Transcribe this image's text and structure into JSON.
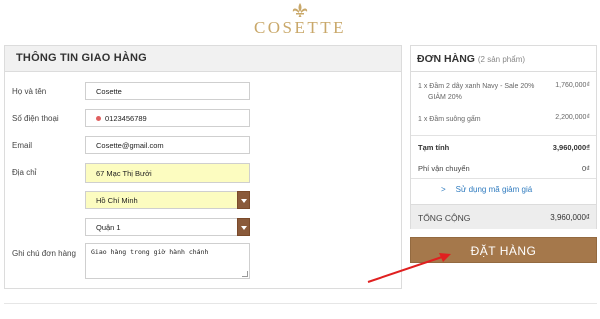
{
  "brand": "COSETTE",
  "shipping": {
    "title": "THÔNG TIN GIAO HÀNG",
    "fields": {
      "name_label": "Họ và tên",
      "name_value": "Cosette",
      "phone_label": "Số điện thoại",
      "phone_value": "0123456789",
      "email_label": "Email",
      "email_value": "Cosette@gmail.com",
      "address_label": "Địa chỉ",
      "address_value": "67 Mạc Thị Bưởi",
      "city_value": "Hồ Chí Minh",
      "district_value": "Quận 1",
      "note_label": "Ghi chú đơn hàng",
      "note_value": "Giao hàng trong giờ hành chánh"
    }
  },
  "order": {
    "title": "ĐƠN HÀNG",
    "count_text": "(2 sản phẩm)",
    "items": [
      {
        "name_line1": "1 x Đầm 2 dây xanh Navy - Sale 20%",
        "name_line2": "GIẢM 20%",
        "price": "1,760,000₫"
      },
      {
        "name_line1": "1 x Đầm suông gấm",
        "name_line2": "",
        "price": "2,200,000₫"
      }
    ],
    "subtotal_label": "Tạm tính",
    "subtotal_value": "3,960,000₫",
    "shipping_label": "Phí vận chuyển",
    "shipping_value": "0₫",
    "coupon_text": "Sử dụng mã giảm giá",
    "coupon_chevron": ">",
    "total_label": "TỔNG CỘNG",
    "total_value": "3,960,000₫",
    "submit_label": "ĐẶT HÀNG"
  },
  "colors": {
    "accent_brown": "#a5784b",
    "logo_gold": "#c9a86a",
    "address_highlight": "#fcfcc0",
    "link_blue": "#2f7bbf",
    "annotation_red": "#e02020"
  },
  "icons": {
    "logo_mark": "fleur-de-lis-icon",
    "select_arrow": "chevron-down-icon",
    "coupon_chevron": "chevron-right-icon",
    "annotation": "red-arrow-icon"
  }
}
